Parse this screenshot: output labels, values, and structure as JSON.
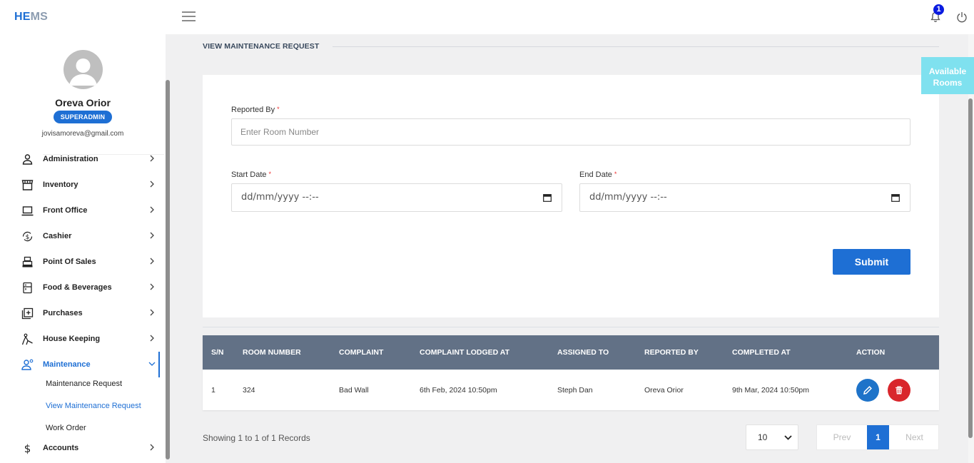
{
  "app": {
    "logo_he": "HE",
    "logo_ms": "MS",
    "notification_count": "1"
  },
  "user": {
    "name": "Oreva Orior",
    "role": "SUPERADMIN",
    "email": "jovisamoreva@gmail.com"
  },
  "sidebar": {
    "items": [
      {
        "label": "Administration",
        "icon": "person-icon"
      },
      {
        "label": "Inventory",
        "icon": "store-icon"
      },
      {
        "label": "Front Office",
        "icon": "laptop-icon"
      },
      {
        "label": "Cashier",
        "icon": "dollar-cycle-icon"
      },
      {
        "label": "Point Of Sales",
        "icon": "cash-register-icon"
      },
      {
        "label": "Food & Beverages",
        "icon": "fridge-icon"
      },
      {
        "label": "Purchases",
        "icon": "add-box-icon"
      },
      {
        "label": "House Keeping",
        "icon": "cleaning-icon"
      },
      {
        "label": "Maintenance",
        "icon": "engineer-icon"
      },
      {
        "label": "Accounts",
        "icon": "dollar-icon"
      }
    ],
    "maintenance_sub": [
      "Maintenance Request",
      "View Maintenance Request",
      "Work Order"
    ]
  },
  "page": {
    "title": "VIEW MAINTENANCE REQUEST",
    "available_rooms": "Available Rooms"
  },
  "form": {
    "reported_by_label": "Reported By",
    "reported_by_placeholder": "Enter Room Number",
    "start_date_label": "Start Date",
    "end_date_label": "End Date",
    "date_placeholder": "dd/mm/yyyy --:--",
    "required_mark": "*",
    "submit_label": "Submit"
  },
  "table": {
    "headers": [
      "S/N",
      "ROOM NUMBER",
      "COMPLAINT",
      "COMPLAINT LODGED AT",
      "ASSIGNED TO",
      "REPORTED BY",
      "COMPLETED AT",
      "ACTION"
    ],
    "rows": [
      {
        "sn": "1",
        "room": "324",
        "complaint": "Bad Wall",
        "lodged": "6th Feb, 2024 10:50pm",
        "assigned": "Steph Dan",
        "reported": "Oreva Orior",
        "completed": "9th Mar, 2024 10:50pm"
      }
    ]
  },
  "pagination": {
    "info": "Showing 1 to 1 of 1 Records",
    "page_size": "10",
    "prev": "Prev",
    "current": "1",
    "next": "Next"
  },
  "colors": {
    "primary": "#1e6fd4",
    "header": "#627186",
    "danger": "#d9262c",
    "accent": "#7fe1ef"
  }
}
